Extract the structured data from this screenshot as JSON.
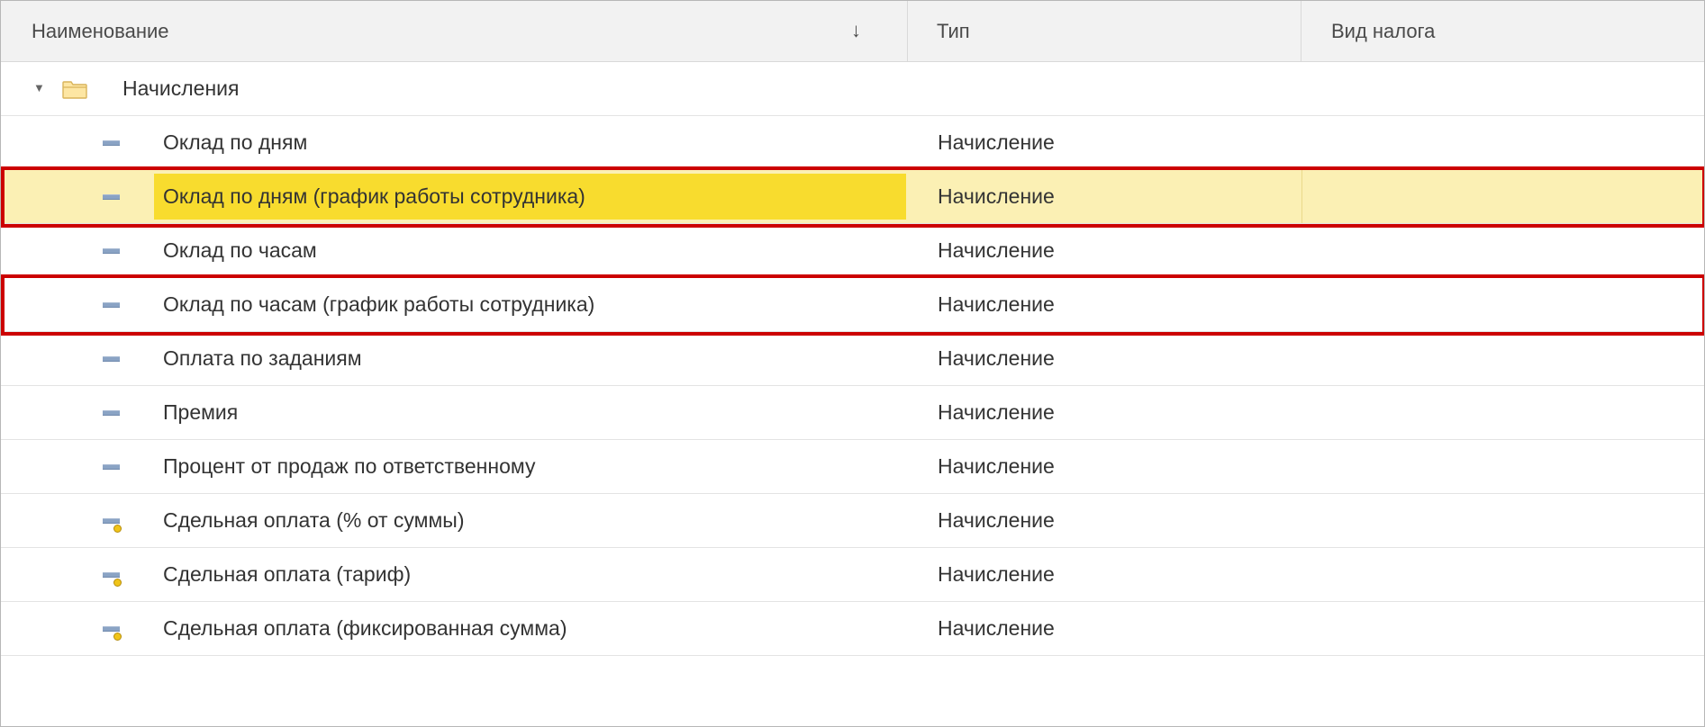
{
  "columns": {
    "name": "Наименование",
    "sort_indicator": "↓",
    "type": "Тип",
    "tax_kind": "Вид налога"
  },
  "group": {
    "label": "Начисления",
    "toggle": "▼"
  },
  "rows": [
    {
      "name": "Оклад по дням",
      "type": "Начисление",
      "icon": "accrual-icon"
    },
    {
      "name": "Оклад по дням (график работы сотрудника)",
      "type": "Начисление",
      "icon": "accrual-icon"
    },
    {
      "name": "Оклад по часам",
      "type": "Начисление",
      "icon": "accrual-icon"
    },
    {
      "name": "Оклад по часам (график работы сотрудника)",
      "type": "Начисление",
      "icon": "accrual-icon"
    },
    {
      "name": "Оплата по заданиям",
      "type": "Начисление",
      "icon": "accrual-icon"
    },
    {
      "name": "Премия",
      "type": "Начисление",
      "icon": "accrual-icon"
    },
    {
      "name": "Процент от продаж по ответственному",
      "type": "Начисление",
      "icon": "accrual-icon"
    },
    {
      "name": "Сдельная оплата (% от суммы)",
      "type": "Начисление",
      "icon": "piecework-accrual-icon"
    },
    {
      "name": "Сдельная оплата (тариф)",
      "type": "Начисление",
      "icon": "piecework-accrual-icon"
    },
    {
      "name": "Сдельная оплата (фиксированная сумма)",
      "type": "Начисление",
      "icon": "piecework-accrual-icon"
    }
  ],
  "selected_row_index": 1,
  "colors": {
    "selected_row": "#fbf0b4",
    "selected_cell": "#f8dc2e",
    "outline": "#cc0000",
    "header_bg": "#f2f2f2"
  }
}
